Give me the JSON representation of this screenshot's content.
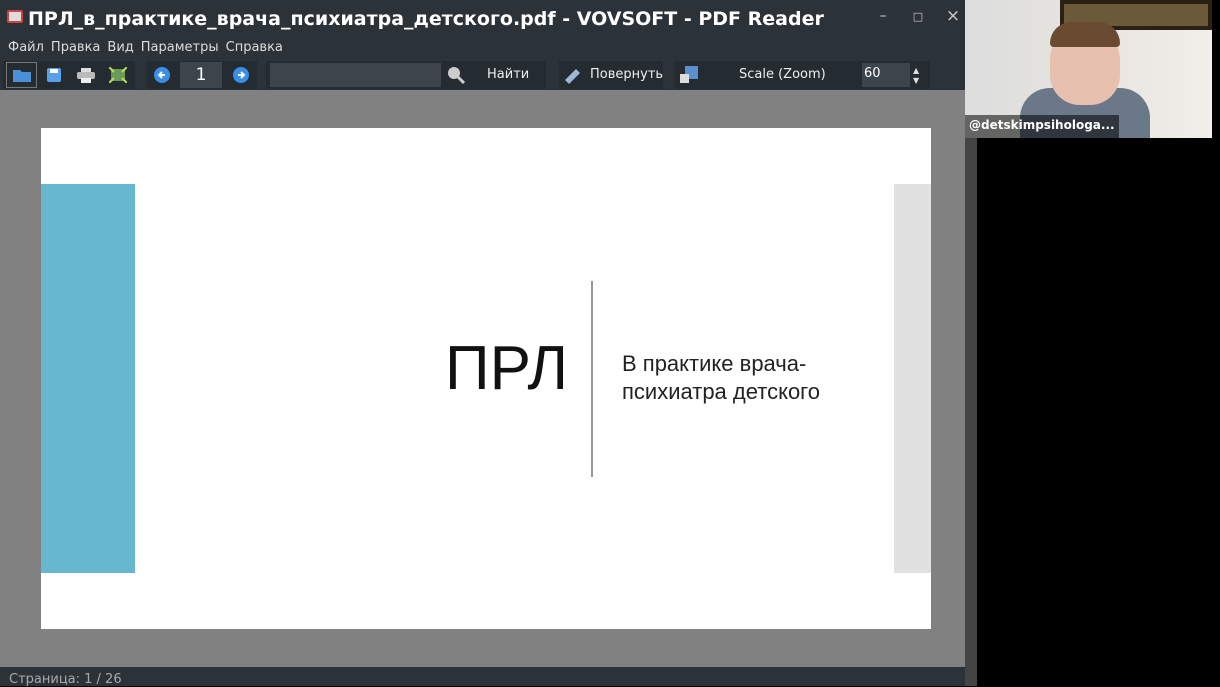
{
  "window": {
    "title": "ПРЛ_в_практике_врача_психиатра_детского.pdf - VOVSOFT - PDF Reader",
    "minimize": "–",
    "maximize": "□",
    "close": "×"
  },
  "menu": [
    "Файл",
    "Правка",
    "Вид",
    "Параметры",
    "Справка"
  ],
  "toolbar": {
    "page": "1",
    "search_value": "",
    "find_label": "Найти",
    "rotate_label": "Повернуть",
    "scale_label": "Scale (Zoom)",
    "zoom_value": "60"
  },
  "slide": {
    "title": "ПРЛ",
    "subtitle_line1": "В практике врача-",
    "subtitle_line2": "психиатра детского",
    "colors": {
      "accent": "#67b7cf"
    }
  },
  "status": "Страница: 1 / 26",
  "webcam": {
    "name": "@detskimpsihologa..."
  }
}
